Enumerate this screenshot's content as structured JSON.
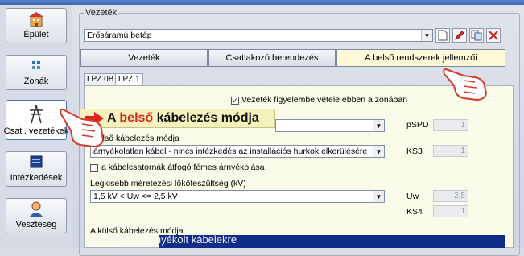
{
  "sidebar": {
    "items": [
      {
        "label": "Épület",
        "icon": "building-icon",
        "active": false
      },
      {
        "label": "Zonák",
        "icon": "zones-icon",
        "active": false
      },
      {
        "label": "Csatl. vezetékek",
        "icon": "power-pylon-icon",
        "active": true
      },
      {
        "label": "Intézkedések",
        "icon": "measures-icon",
        "active": false
      },
      {
        "label": "Veszteség",
        "icon": "person-loss-icon",
        "active": false
      }
    ]
  },
  "main": {
    "group_title": "Vezeték",
    "line_select": "Erősáramú betáp",
    "tabs": [
      {
        "label": "Vezeték",
        "active": false
      },
      {
        "label": "Csatlakozó berendezés",
        "active": false
      },
      {
        "label": "A belső rendszerek jellemzői",
        "active": true
      }
    ],
    "subtabs": [
      {
        "label": "LPZ 0B",
        "active": false
      },
      {
        "label": "LPZ 1",
        "active": true
      }
    ],
    "consider_line_checkbox": {
      "label": "Vezeték figyelembe vétele ebben a zónában",
      "checked": true
    },
    "spd_field": {
      "label": "pSPD",
      "value": "1"
    },
    "internal_wiring": {
      "label": "belső kábelezés módja",
      "value": "árnyékolatlan kábel - nincs intézkedés az installációs hurkok elkerülésére"
    },
    "ks3": {
      "label": "KS3",
      "value": "1"
    },
    "duct_checkbox": {
      "label": "a kábelcsatornák átfogó fémes árnyékolása",
      "checked": false
    },
    "withstand_voltage": {
      "label": "Legkisebb méretezési lökőfeszültség (kV)",
      "value": "1,5 kV < Uw <= 2,5 kV"
    },
    "uw": {
      "label": "Uw",
      "value": "2,5"
    },
    "ks4": {
      "label": "KS4",
      "value": "1"
    },
    "external_wiring_label": "A külső kábelezés módja"
  },
  "callout": {
    "prefix": "A ",
    "highlight": "belső",
    "suffix": " kábelezés módja"
  },
  "bottom_caption": "Példák árnyékolt kábelekre",
  "colors": {
    "highlight_red": "#d8261b",
    "active_tab": "#fff9d8",
    "panel": "#fbfbe9",
    "bottom_bar": "#0f2c86"
  }
}
